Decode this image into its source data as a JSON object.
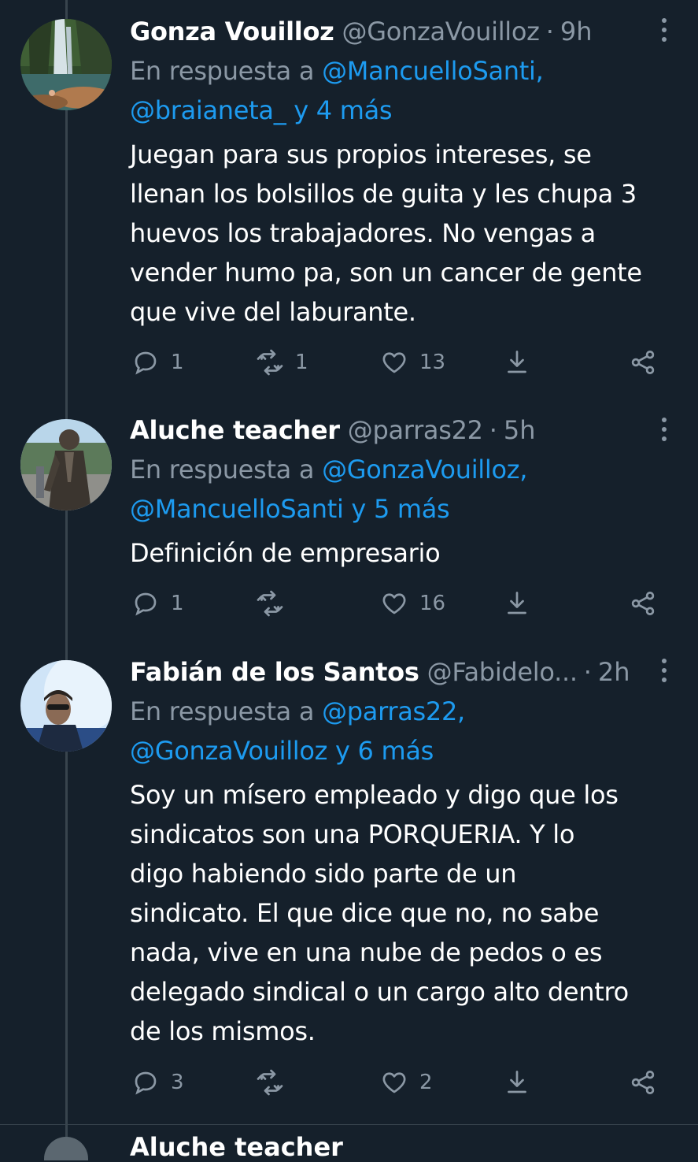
{
  "tweets": [
    {
      "name": "Gonza Vouilloz",
      "handle": "@GonzaVouilloz",
      "time": "9h",
      "reply_prefix": "En respuesta a ",
      "reply_line1": "@MancuelloSanti,",
      "reply_line2": "@braianeta_ y 4 más",
      "text_lines": [
        "Juegan para sus propios intereses, se",
        "llenan los bolsillos de guita y les chupa 3",
        "huevos los trabajadores. No vengas a",
        "vender humo pa, son un cancer de gente",
        "que vive del laburante."
      ],
      "replies": "1",
      "retweets": "1",
      "likes": "13",
      "avatar_icon": "waterfall-photo-avatar"
    },
    {
      "name": "Aluche teacher",
      "handle": "@parras22",
      "time": "5h",
      "reply_prefix": "En respuesta a ",
      "reply_line1": "@GonzaVouilloz,",
      "reply_line2": "@MancuelloSanti y 5 más",
      "text_lines": [
        "Definición de empresario"
      ],
      "replies": "1",
      "retweets": "",
      "likes": "16",
      "avatar_icon": "statue-photo-avatar"
    },
    {
      "name": "Fabián de los Santos",
      "handle": "@Fabidelo...",
      "time": "2h",
      "reply_prefix": "En respuesta a ",
      "reply_line1": "@parras22,",
      "reply_line2": "@GonzaVouilloz y 6 más",
      "text_lines": [
        "Soy un mísero empleado y digo que los",
        "sindicatos son una PORQUERIA. Y lo",
        "digo habiendo sido parte de un",
        "sindicato. El que dice que no, no sabe",
        "nada, vive en una nube de pedos o es",
        "delegado sindical o un cargo alto dentro",
        "de los mismos."
      ],
      "replies": "3",
      "retweets": "",
      "likes": "2",
      "avatar_icon": "man-sunglasses-photo-avatar"
    }
  ],
  "peek_name": "Aluche teacher",
  "colors": {
    "background": "#15202b",
    "text": "#ffffff",
    "muted": "#8b98a5",
    "link": "#1d9bf0",
    "border": "#38444d"
  },
  "icons": [
    "reply-icon",
    "retweet-icon",
    "like-icon",
    "share-icon",
    "upload-icon",
    "more-icon"
  ]
}
